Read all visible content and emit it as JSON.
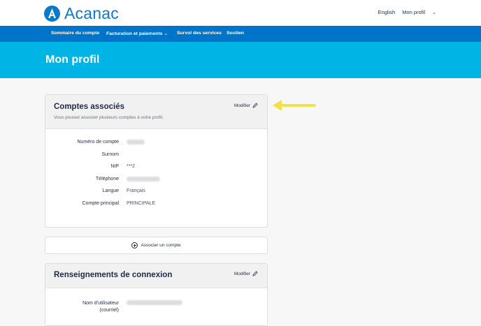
{
  "brand": {
    "name": "Acanac",
    "color": "#0a79c9"
  },
  "top_links": {
    "language": "English",
    "profile": "Mon profil"
  },
  "nav": {
    "items": [
      {
        "label": "Sommaire du compte"
      },
      {
        "label": "Facturation et paiements"
      },
      {
        "label": "Survol des services"
      },
      {
        "label": "Soutien"
      }
    ]
  },
  "hero": {
    "title": "Mon profil"
  },
  "accounts_card": {
    "title": "Comptes associés",
    "subtitle": "Vous pouvez associer plusieurs comptes à votre profil.",
    "edit_label": "Modifier",
    "fields": [
      {
        "label": "Numéro de compte",
        "value": ""
      },
      {
        "label": "Surnom",
        "value": ""
      },
      {
        "label": "NIP",
        "value": "***2"
      },
      {
        "label": "Téléphone",
        "value": ""
      },
      {
        "label": "Langue",
        "value": "Français"
      },
      {
        "label": "Compte principal",
        "value": "PRINCIPALE"
      }
    ]
  },
  "associate_button": {
    "label": "Associer un compte"
  },
  "login_card": {
    "title": "Renseignements de connexion",
    "edit_label": "Modifier",
    "fields": [
      {
        "label_line1": "Nom d'utilisateur",
        "label_line2": "(courriel)",
        "value": ""
      }
    ]
  },
  "colors": {
    "nav": "#0074c8",
    "hero": "#00b4e6",
    "highlight_arrow": "#f5e04a"
  }
}
